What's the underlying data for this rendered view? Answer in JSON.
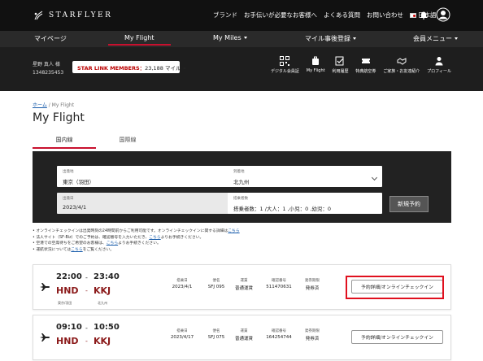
{
  "header": {
    "brand": "STARFLYER",
    "links": [
      "ブランド",
      "お手伝いが必要なお客様へ",
      "よくある質問",
      "お問い合わせ",
      "日本語"
    ],
    "icons": [
      "bell-icon",
      "user-icon"
    ]
  },
  "nav": {
    "items": [
      {
        "label": "マイページ",
        "dropdown": false,
        "active": false
      },
      {
        "label": "My Flight",
        "dropdown": false,
        "active": true
      },
      {
        "label": "My Miles",
        "dropdown": true,
        "active": false
      },
      {
        "label": "マイル事後登録",
        "dropdown": true,
        "active": false
      },
      {
        "label": "会員メニュー",
        "dropdown": true,
        "active": false
      }
    ],
    "accent": "#c8102e"
  },
  "member": {
    "name": "星野 真人 様",
    "number": "1348235453",
    "tier_label": "STAR LINK MEMBERS：",
    "miles": "23,188 マイル",
    "menu": [
      {
        "label": "デジタル会員証",
        "icon": "qr-code-icon"
      },
      {
        "label": "My Flight",
        "icon": "luggage-icon"
      },
      {
        "label": "利用履歴",
        "icon": "checklist-icon"
      },
      {
        "label": "特典航空券",
        "icon": "ticket-icon"
      },
      {
        "label": "ご家族・お友達紹介",
        "icon": "handshake-icon"
      },
      {
        "label": "プロフィール",
        "icon": "profile-icon"
      }
    ]
  },
  "breadcrumb": {
    "home": "ホーム",
    "sep": " / ",
    "current": "My Flight"
  },
  "page_title": "My Flight",
  "tabs": {
    "domestic": "国内線",
    "international": "国際線"
  },
  "search": {
    "departure": {
      "label": "出発地",
      "value": "東京（羽田）"
    },
    "arrival": {
      "label": "到着地",
      "value": "北九州"
    },
    "date": {
      "label": "出発日",
      "value": "2023/4/1"
    },
    "passengers": {
      "label": "搭乗者数",
      "value": "搭乗者数：1 /大人：1 ,小児：0 ,幼児：0"
    },
    "new_booking": "新規予約"
  },
  "notes": [
    {
      "text": "オンラインチェックインは出発時刻の24時間前からご利用可能です。オンラインチェックインに関する詳細は",
      "link": "こちら"
    },
    {
      "text": "法人サイト（SF-Biz）でのご予約は、確認番号を入力いただき、",
      "link": "こちら",
      "after": "よりお手続きください。"
    },
    {
      "text": "空港での空席待ちをご希望のお客様は、",
      "link": "こちら",
      "after": "よりお手続きください。"
    },
    {
      "text": "運航状況については",
      "link": "こちら",
      "after": "をご覧ください。"
    }
  ],
  "flights": [
    {
      "dep_time": "22:00",
      "arr_time": "23:40",
      "dep_code": "HND",
      "arr_code": "KKJ",
      "dep_city": "東京/羽田",
      "arr_city": "北九州",
      "date_label": "搭乗日",
      "date": "2023/4/1",
      "flight_label": "便名",
      "flight": "SFJ 095",
      "fare_label": "運賃",
      "fare": "普通運賃",
      "conf_label": "確認番号",
      "conf": "511470631",
      "ticket_label": "発券期限",
      "ticket": "発券済",
      "button": "予約詳細/オンラインチェックイン"
    },
    {
      "dep_time": "09:10",
      "arr_time": "10:50",
      "dep_code": "HND",
      "arr_code": "KKJ",
      "dep_city": "東京/羽田",
      "arr_city": "北九州",
      "date_label": "搭乗日",
      "date": "2023/4/17",
      "flight_label": "便名",
      "flight": "SFJ 075",
      "fare_label": "運賃",
      "fare": "普通運賃",
      "conf_label": "確認番号",
      "conf": "164254744",
      "ticket_label": "発券期限",
      "ticket": "発券済",
      "button": "予約詳細/オンラインチェックイン"
    }
  ],
  "colors": {
    "route_code": "#8b1a1a",
    "highlight": "#e0101e",
    "header_bg": "#111111"
  }
}
